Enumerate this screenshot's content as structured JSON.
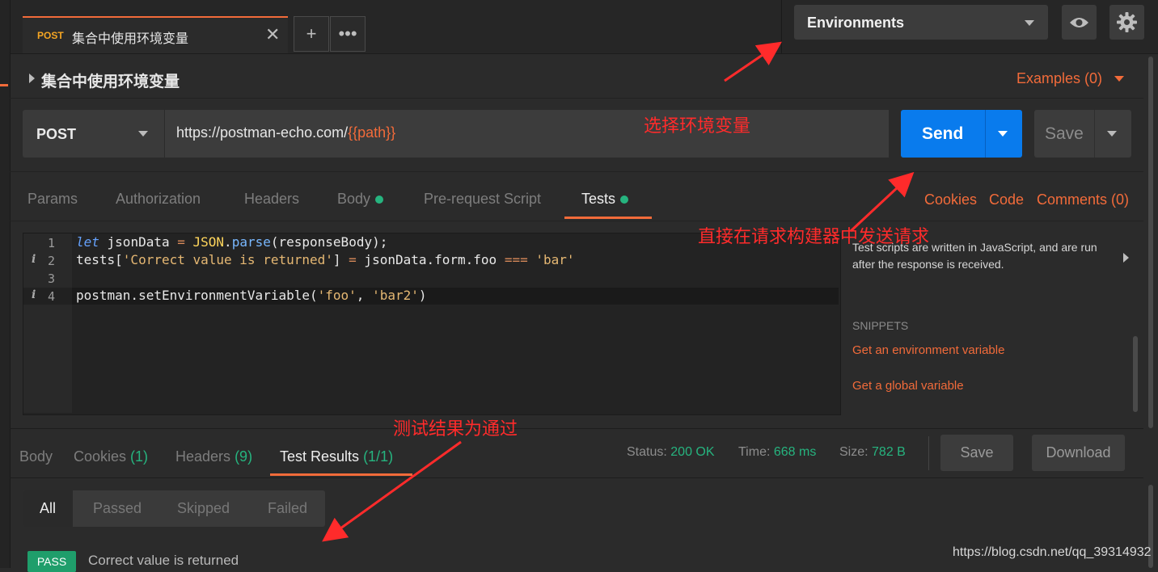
{
  "tab": {
    "method": "POST",
    "title": "集合中使用环境变量"
  },
  "environment": {
    "selected": "Environments"
  },
  "request": {
    "name": "集合中使用环境变量",
    "examples": "Examples (0)",
    "method": "POST",
    "url_base": "https://postman-echo.com/",
    "url_var": "{{path}}",
    "send": "Send",
    "save": "Save"
  },
  "sub_tabs": [
    "Params",
    "Authorization",
    "Headers",
    "Body",
    "Pre-request Script",
    "Tests"
  ],
  "right_links": {
    "cookies": "Cookies",
    "code": "Code",
    "comments": "Comments (0)"
  },
  "editor": {
    "line_numbers": [
      "1",
      "2",
      "3",
      "4"
    ],
    "lines": [
      "let jsonData = JSON.parse(responseBody);",
      "tests['Correct value is returned'] = jsonData.form.foo === 'bar'",
      "",
      "postman.setEnvironmentVariable('foo', 'bar2')"
    ]
  },
  "side_panel": {
    "description": "Test scripts are written in JavaScript, and are run after the response is received.",
    "snippets_header": "SNIPPETS",
    "snippets": [
      "Get an environment variable",
      "Get a global variable"
    ]
  },
  "response": {
    "tabs": [
      {
        "label": "Body",
        "count": ""
      },
      {
        "label": "Cookies",
        "count": "(1)"
      },
      {
        "label": "Headers",
        "count": "(9)"
      },
      {
        "label": "Test Results",
        "count": "(1/1)"
      }
    ],
    "status_label": "Status:",
    "status": "200 OK",
    "time_label": "Time:",
    "time": "668 ms",
    "size_label": "Size:",
    "size": "782 B",
    "save": "Save",
    "download": "Download"
  },
  "filters": [
    "All",
    "Passed",
    "Skipped",
    "Failed"
  ],
  "results": [
    {
      "badge": "PASS",
      "name": "Correct value is returned"
    }
  ],
  "annotations": {
    "env": "选择环境变量",
    "send": "直接在请求构建器中发送请求",
    "result": "测试结果为通过"
  },
  "watermark": "https://blog.csdn.net/qq_39314932",
  "colors": {
    "accent": "#f26b3a",
    "send": "#097bed",
    "success": "#26b47f",
    "annotation": "#ff2b2b"
  }
}
